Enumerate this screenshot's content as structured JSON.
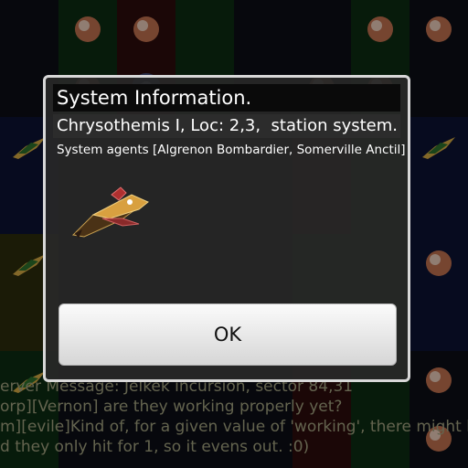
{
  "dialog": {
    "title": "System Information.",
    "subtitle": "Chrysothemis I, Loc: 2,3,  station system.",
    "agents": "System agents [Algrenon Bombardier, Somerville Anctil]",
    "ship_icon": "fighter-ship-icon",
    "ok_label": "OK"
  },
  "chat": {
    "lines": [
      "erver Message: Jelkek incursion, sector 84,31",
      "orp][Vernon] are they working properly yet?",
      "m][evile]Kind of, for a given value of 'working', there might be qu",
      "d they only hit for 1, so it evens out. :0)"
    ]
  },
  "board": {
    "columns": 8,
    "rows": 8,
    "tiles": [
      "-",
      "planet-icon",
      "planet-icon",
      "-",
      "-",
      "-",
      "planet-icon",
      "planet-icon",
      "-",
      "planet-icon",
      "nebula-icon",
      "-",
      "-",
      "planet-icon",
      "planet-icon",
      "-",
      "ship-icon",
      "-",
      "-",
      "-",
      "-",
      "-",
      "-",
      "ship-icon",
      "-",
      "-",
      "-",
      "-",
      "-",
      "-",
      "-",
      "-",
      "ship-icon",
      "-",
      "-",
      "-",
      "-",
      "-",
      "-",
      "planet-icon",
      "-",
      "-",
      "-",
      "-",
      "-",
      "-",
      "-",
      "-",
      "ship-icon",
      "-",
      "-",
      "-",
      "-",
      "-",
      "-",
      "planet-icon",
      "-",
      "-",
      "-",
      "-",
      "-",
      "-",
      "-",
      "planet-icon"
    ],
    "tile_colors": [
      "#0b0d14",
      "#0b2a12",
      "#2a0b0b",
      "#0b2a12",
      "#0b0d14",
      "#0b0d14",
      "#0b2a12",
      "#0b0d14",
      "#0b0d14",
      "#0b2a12",
      "#2a0b0b",
      "#0b2a12",
      "#0b0d14",
      "#0b0d14",
      "#0b2a12",
      "#0b0d14",
      "#0b1230",
      "#0b0d14",
      "#0b0d14",
      "#0b0d14",
      "#0b0d14",
      "#2a0b0b",
      "#0b2a12",
      "#0b1230",
      "#0b1230",
      "#0b0d14",
      "#0b0d14",
      "#0b0d14",
      "#0b0d14",
      "#2a0b0b",
      "#0b2a12",
      "#0b1230",
      "#2a2a0b",
      "#0b0d14",
      "#0b0d14",
      "#0b0d14",
      "#0b0d14",
      "#0b2a12",
      "#0b2a12",
      "#0b1230",
      "#2a2a0b",
      "#0b0d14",
      "#0b0d14",
      "#0b0d14",
      "#0b0d14",
      "#0b2a12",
      "#0b2a12",
      "#0b1230",
      "#0b2a12",
      "#0b0d14",
      "#0b0d14",
      "#0b0d14",
      "#0b0d14",
      "#2a0b0b",
      "#0b2a12",
      "#0b0d14",
      "#0b2a12",
      "#0b0d14",
      "#0b0d14",
      "#0b0d14",
      "#0b0d14",
      "#2a0b0b",
      "#0b2a12",
      "#0b0d14"
    ]
  }
}
